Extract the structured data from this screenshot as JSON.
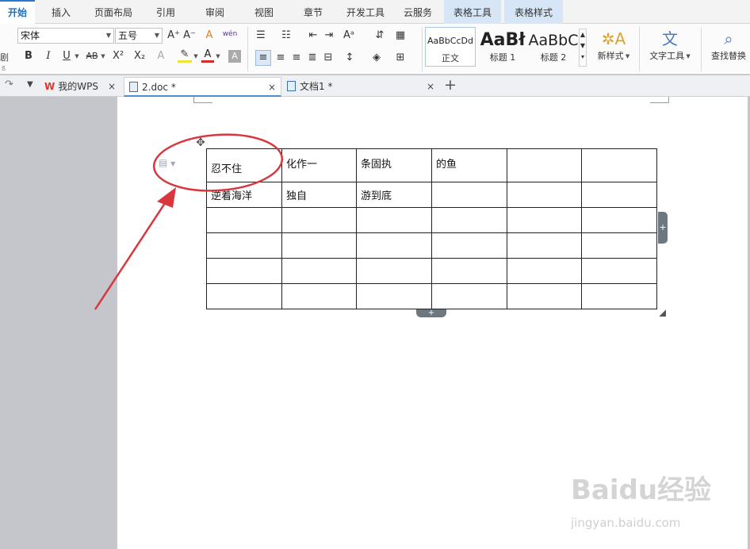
{
  "ribbon_tabs": [
    "开始",
    "插入",
    "页面布局",
    "引用",
    "审阅",
    "视图",
    "章节",
    "开发工具",
    "云服务",
    "表格工具",
    "表格样式"
  ],
  "font": {
    "name": "宋体",
    "size": "五号"
  },
  "format_buttons": {
    "bold": "B",
    "italic": "I",
    "underline": "U",
    "strike": "AB",
    "superscript": "X²",
    "subscript": "X₂",
    "font_color": "A",
    "highlight": "A",
    "char_shade": "A",
    "grow": "A⁺",
    "shrink": "A⁻",
    "clear": "A",
    "phonetic": "wén"
  },
  "styles": [
    {
      "sample": "AaBbCcDd",
      "label": "正文"
    },
    {
      "sample": "AaBł",
      "label": "标题 1"
    },
    {
      "sample": "AaBbC",
      "label": "标题 2"
    }
  ],
  "big_buttons": {
    "new_style": "新样式",
    "text_tools": "文字工具",
    "find_replace": "查找替换"
  },
  "left_edge_labels": [
    "剧",
    "ß"
  ],
  "doc_tabs": [
    {
      "label": "我的WPS",
      "logo": "W"
    },
    {
      "label": "2.doc *"
    },
    {
      "label": "文档1 *"
    }
  ],
  "new_tab": "+",
  "table": {
    "rows": [
      [
        "忍不住",
        "化作一",
        "条固执",
        "的鱼",
        "",
        ""
      ],
      [
        "逆着海洋",
        "独自",
        "游到底",
        "",
        "",
        ""
      ],
      [
        "",
        "",
        "",
        "",
        "",
        ""
      ],
      [
        "",
        "",
        "",
        "",
        "",
        ""
      ],
      [
        "",
        "",
        "",
        "",
        "",
        ""
      ],
      [
        "",
        "",
        "",
        "",
        "",
        ""
      ]
    ]
  },
  "add_symbol": "+",
  "watermark": {
    "brand": "Baidu经验",
    "url": "jingyan.baidu.com"
  },
  "annotation_color": "#d9363e",
  "accent_color": "#2b79c9"
}
